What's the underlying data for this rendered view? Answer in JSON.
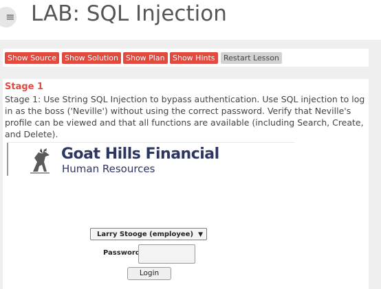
{
  "header": {
    "menu_icon": "hamburger-menu-icon",
    "title": "LAB: SQL Injection"
  },
  "toolbar": {
    "buttons": [
      {
        "label": "Show Source"
      },
      {
        "label": "Show Solution"
      },
      {
        "label": "Show Plan"
      },
      {
        "label": "Show Hints"
      },
      {
        "label": "Restart Lesson"
      }
    ]
  },
  "lesson": {
    "stage_title": "Stage 1",
    "stage_description": "Stage 1: Use String SQL Injection to bypass authentication. Use SQL injection to log in as the boss ('Neville') without using the correct password. Verify that Neville's profile can be viewed and that all functions are available (including Search, Create, and Delete)."
  },
  "banner": {
    "company": "Goat Hills Financial",
    "department": "Human Resources",
    "logo_icon": "goat-logo-icon"
  },
  "login_form": {
    "employee_select": {
      "selected": "Larry Stooge (employee)"
    },
    "password_label": "Password",
    "password_value": "",
    "login_label": "Login"
  },
  "colors": {
    "accent": "#e04a3f",
    "restart_button": "#d2d2d2",
    "banner_text": "#2d3561",
    "page_background": "#efefef"
  }
}
